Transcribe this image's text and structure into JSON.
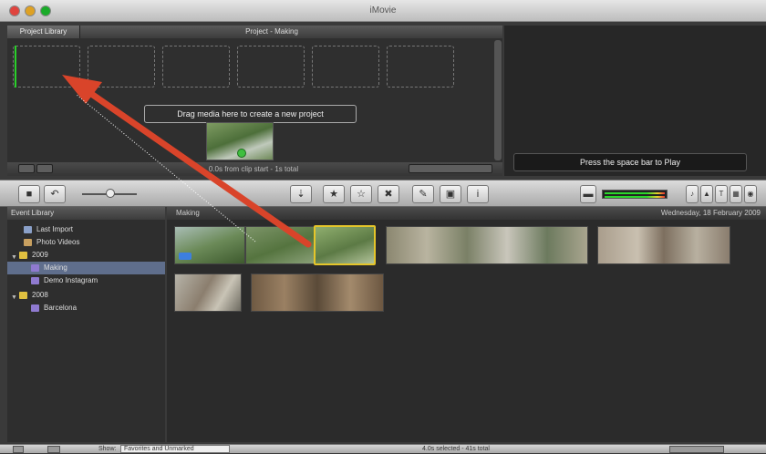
{
  "window": {
    "title": "iMovie"
  },
  "project": {
    "library_button": "Project Library",
    "title": "Project - Making",
    "drag_hint": "Drag media here to create a new project",
    "footer_status": "0.0s from clip start - 1s total"
  },
  "viewer": {
    "play_hint": "Press the space bar to Play"
  },
  "toolbar": {
    "icons": [
      "camera-icon",
      "undo-icon",
      "add-to-project-icon",
      "favorite-star-icon",
      "unmark-star-icon",
      "reject-x-icon",
      "keyword-icon",
      "crop-icon",
      "info-icon"
    ]
  },
  "events": {
    "header": "Event Library",
    "items": [
      {
        "label": "Last Import"
      },
      {
        "label": "Photo Videos"
      },
      {
        "label": "2009"
      },
      {
        "label": "Making"
      },
      {
        "label": "Demo Instagram"
      },
      {
        "label": "2008"
      },
      {
        "label": "Barcelona"
      }
    ]
  },
  "clips": {
    "event_name": "Making",
    "date": "Wednesday, 18 February 2009"
  },
  "bottom": {
    "show_label": "Show:",
    "show_value": "Favorites and Unmarked",
    "status": "4.0s selected - 41s total"
  },
  "colors": {
    "selection": "#e5c52a",
    "arrow": "#d9442a",
    "playhead": "#2ad02a"
  }
}
